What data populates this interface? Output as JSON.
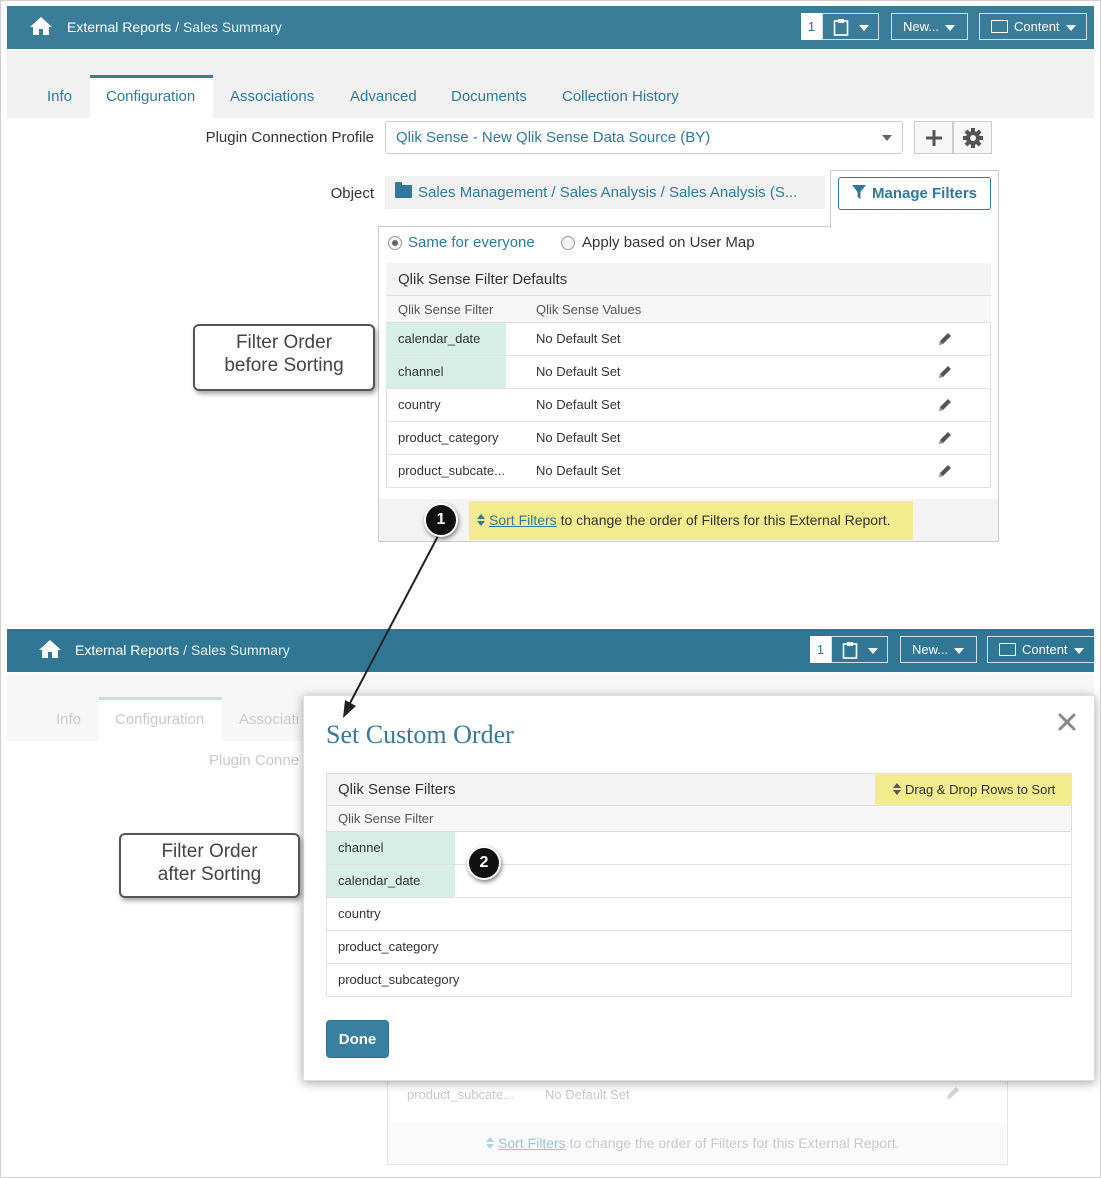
{
  "top": {
    "app_section": "External Reports",
    "separator": " / ",
    "page": "Sales Summary",
    "count": "1",
    "new_label": "New...",
    "content_label": "Content"
  },
  "tabs": [
    {
      "label": "Info"
    },
    {
      "label": "Configuration",
      "active": true
    },
    {
      "label": "Associations"
    },
    {
      "label": "Advanced"
    },
    {
      "label": "Documents"
    },
    {
      "label": "Collection History"
    }
  ],
  "form": {
    "plugin_label": "Plugin Connection Profile",
    "plugin_value": "Qlik Sense - New Qlik Sense Data Source (BY)",
    "object_label": "Object",
    "object_value": "Sales Management / Sales Analysis / Sales Analysis (S...",
    "manage_filters": "Manage Filters"
  },
  "filters": {
    "radio_same": "Same for everyone",
    "radio_user_map": "Apply based on User Map",
    "title": "Qlik Sense Filter Defaults",
    "col_filter": "Qlik Sense Filter",
    "col_values": "Qlik Sense Values",
    "rows": [
      {
        "filter": "calendar_date",
        "value": "No Default Set"
      },
      {
        "filter": "channel",
        "value": "No Default Set"
      },
      {
        "filter": "country",
        "value": "No Default Set"
      },
      {
        "filter": "product_category",
        "value": "No Default Set"
      },
      {
        "filter": "product_subcate...",
        "value": "No Default Set"
      }
    ],
    "sort_link": "Sort Filters",
    "sort_text": " to change the order of Filters for this External Report."
  },
  "callouts": {
    "before_line1": "Filter Order",
    "before_line2": "before Sorting",
    "after_line1": "Filter Order",
    "after_line2": "after Sorting",
    "marker1": "1",
    "marker2": "2"
  },
  "lower_bg": {
    "tab_info": "Info",
    "tab_config": "Configuration",
    "tab_assoc": "Associati",
    "plugin_label": "Plugin Conne",
    "row_filter": "product_subcate...",
    "row_value": "No Default Set",
    "sort_link": "Sort Filters",
    "sort_text": " to change the order of Filters for this External Report."
  },
  "modal": {
    "title": "Set Custom Order",
    "table_title": "Qlik Sense Filters",
    "drag_badge": "Drag & Drop Rows to Sort",
    "col_filter": "Qlik Sense Filter",
    "rows": [
      "channel",
      "calendar_date",
      "country",
      "product_category",
      "product_subcategory"
    ],
    "done": "Done"
  },
  "colors": {
    "topbar": "#3b7d99",
    "accent": "#2f7a9a",
    "highlight_row": "#d7efe6",
    "note_yellow": "#f2ec8e"
  }
}
